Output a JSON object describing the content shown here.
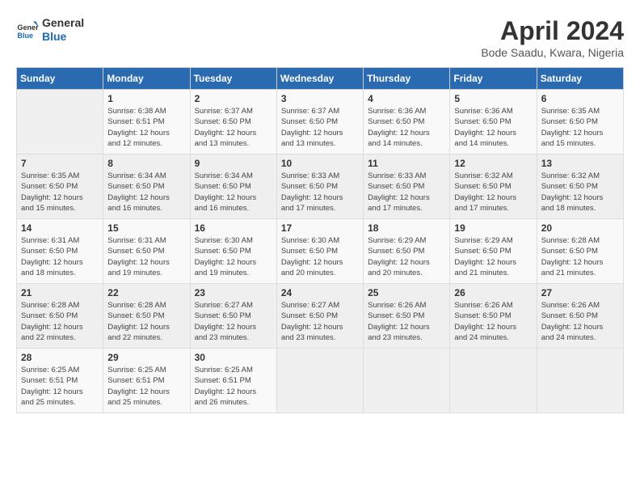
{
  "logo": {
    "line1": "General",
    "line2": "Blue"
  },
  "title": "April 2024",
  "location": "Bode Saadu, Kwara, Nigeria",
  "headers": [
    "Sunday",
    "Monday",
    "Tuesday",
    "Wednesday",
    "Thursday",
    "Friday",
    "Saturday"
  ],
  "weeks": [
    [
      {
        "day": "",
        "info": ""
      },
      {
        "day": "1",
        "info": "Sunrise: 6:38 AM\nSunset: 6:51 PM\nDaylight: 12 hours\nand 12 minutes."
      },
      {
        "day": "2",
        "info": "Sunrise: 6:37 AM\nSunset: 6:50 PM\nDaylight: 12 hours\nand 13 minutes."
      },
      {
        "day": "3",
        "info": "Sunrise: 6:37 AM\nSunset: 6:50 PM\nDaylight: 12 hours\nand 13 minutes."
      },
      {
        "day": "4",
        "info": "Sunrise: 6:36 AM\nSunset: 6:50 PM\nDaylight: 12 hours\nand 14 minutes."
      },
      {
        "day": "5",
        "info": "Sunrise: 6:36 AM\nSunset: 6:50 PM\nDaylight: 12 hours\nand 14 minutes."
      },
      {
        "day": "6",
        "info": "Sunrise: 6:35 AM\nSunset: 6:50 PM\nDaylight: 12 hours\nand 15 minutes."
      }
    ],
    [
      {
        "day": "7",
        "info": "Sunrise: 6:35 AM\nSunset: 6:50 PM\nDaylight: 12 hours\nand 15 minutes."
      },
      {
        "day": "8",
        "info": "Sunrise: 6:34 AM\nSunset: 6:50 PM\nDaylight: 12 hours\nand 16 minutes."
      },
      {
        "day": "9",
        "info": "Sunrise: 6:34 AM\nSunset: 6:50 PM\nDaylight: 12 hours\nand 16 minutes."
      },
      {
        "day": "10",
        "info": "Sunrise: 6:33 AM\nSunset: 6:50 PM\nDaylight: 12 hours\nand 17 minutes."
      },
      {
        "day": "11",
        "info": "Sunrise: 6:33 AM\nSunset: 6:50 PM\nDaylight: 12 hours\nand 17 minutes."
      },
      {
        "day": "12",
        "info": "Sunrise: 6:32 AM\nSunset: 6:50 PM\nDaylight: 12 hours\nand 17 minutes."
      },
      {
        "day": "13",
        "info": "Sunrise: 6:32 AM\nSunset: 6:50 PM\nDaylight: 12 hours\nand 18 minutes."
      }
    ],
    [
      {
        "day": "14",
        "info": "Sunrise: 6:31 AM\nSunset: 6:50 PM\nDaylight: 12 hours\nand 18 minutes."
      },
      {
        "day": "15",
        "info": "Sunrise: 6:31 AM\nSunset: 6:50 PM\nDaylight: 12 hours\nand 19 minutes."
      },
      {
        "day": "16",
        "info": "Sunrise: 6:30 AM\nSunset: 6:50 PM\nDaylight: 12 hours\nand 19 minutes."
      },
      {
        "day": "17",
        "info": "Sunrise: 6:30 AM\nSunset: 6:50 PM\nDaylight: 12 hours\nand 20 minutes."
      },
      {
        "day": "18",
        "info": "Sunrise: 6:29 AM\nSunset: 6:50 PM\nDaylight: 12 hours\nand 20 minutes."
      },
      {
        "day": "19",
        "info": "Sunrise: 6:29 AM\nSunset: 6:50 PM\nDaylight: 12 hours\nand 21 minutes."
      },
      {
        "day": "20",
        "info": "Sunrise: 6:28 AM\nSunset: 6:50 PM\nDaylight: 12 hours\nand 21 minutes."
      }
    ],
    [
      {
        "day": "21",
        "info": "Sunrise: 6:28 AM\nSunset: 6:50 PM\nDaylight: 12 hours\nand 22 minutes."
      },
      {
        "day": "22",
        "info": "Sunrise: 6:28 AM\nSunset: 6:50 PM\nDaylight: 12 hours\nand 22 minutes."
      },
      {
        "day": "23",
        "info": "Sunrise: 6:27 AM\nSunset: 6:50 PM\nDaylight: 12 hours\nand 23 minutes."
      },
      {
        "day": "24",
        "info": "Sunrise: 6:27 AM\nSunset: 6:50 PM\nDaylight: 12 hours\nand 23 minutes."
      },
      {
        "day": "25",
        "info": "Sunrise: 6:26 AM\nSunset: 6:50 PM\nDaylight: 12 hours\nand 23 minutes."
      },
      {
        "day": "26",
        "info": "Sunrise: 6:26 AM\nSunset: 6:50 PM\nDaylight: 12 hours\nand 24 minutes."
      },
      {
        "day": "27",
        "info": "Sunrise: 6:26 AM\nSunset: 6:50 PM\nDaylight: 12 hours\nand 24 minutes."
      }
    ],
    [
      {
        "day": "28",
        "info": "Sunrise: 6:25 AM\nSunset: 6:51 PM\nDaylight: 12 hours\nand 25 minutes."
      },
      {
        "day": "29",
        "info": "Sunrise: 6:25 AM\nSunset: 6:51 PM\nDaylight: 12 hours\nand 25 minutes."
      },
      {
        "day": "30",
        "info": "Sunrise: 6:25 AM\nSunset: 6:51 PM\nDaylight: 12 hours\nand 26 minutes."
      },
      {
        "day": "",
        "info": ""
      },
      {
        "day": "",
        "info": ""
      },
      {
        "day": "",
        "info": ""
      },
      {
        "day": "",
        "info": ""
      }
    ]
  ]
}
